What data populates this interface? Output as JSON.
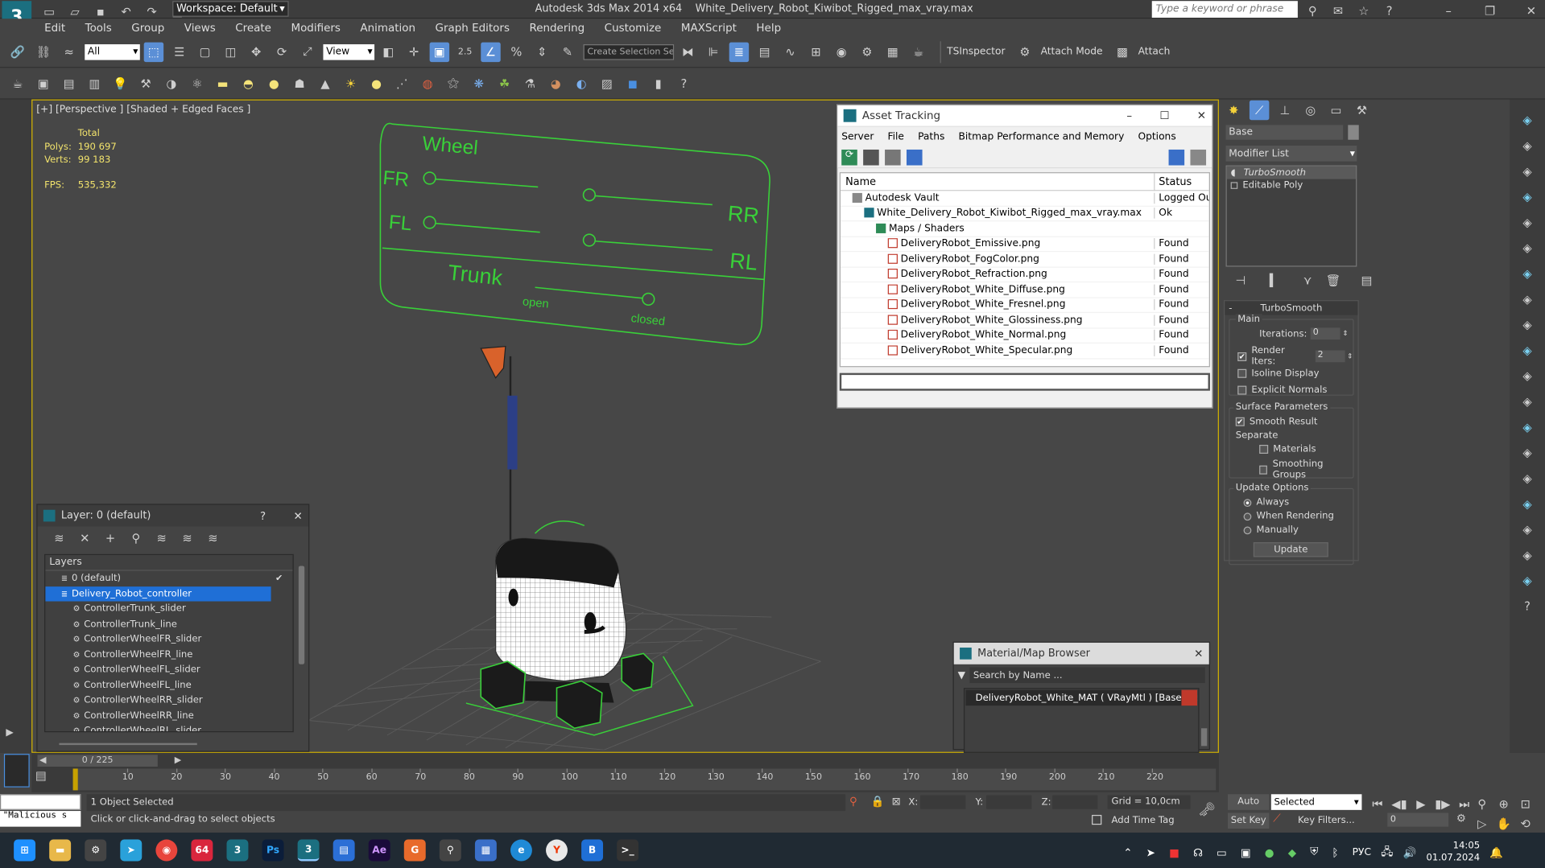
{
  "title": {
    "workspace": "Workspace: Default",
    "app": "Autodesk 3ds Max  2014 x64",
    "file": "White_Delivery_Robot_Kiwibot_Rigged_max_vray.max",
    "search_placeholder": "Type a keyword or phrase"
  },
  "menu": [
    "Edit",
    "Tools",
    "Group",
    "Views",
    "Create",
    "Modifiers",
    "Animation",
    "Graph Editors",
    "Rendering",
    "Customize",
    "MAXScript",
    "Help"
  ],
  "toolbar": {
    "filter": "All",
    "ref_coord": "View",
    "snap_value": "2.5",
    "selection_set_placeholder": "Create Selection Se",
    "tsinspector": "TSInspector",
    "attach_mode": "Attach Mode",
    "attach": "Attach"
  },
  "viewport": {
    "label": "[+] [Perspective ] [Shaded + Edged Faces ]",
    "stats_total": "Total",
    "polys_label": "Polys:",
    "polys_value": "190 697",
    "verts_label": "Verts:",
    "verts_value": "99 183",
    "fps_label": "FPS:",
    "fps_value": "535,332",
    "controller": {
      "wheel": "Wheel",
      "fr": "FR",
      "fl": "FL",
      "rr": "RR",
      "rl": "RL",
      "trunk": "Trunk",
      "open": "open",
      "closed": "closed"
    }
  },
  "asset_tracking": {
    "title": "Asset Tracking",
    "menu": [
      "Server",
      "File",
      "Paths",
      "Bitmap Performance and Memory",
      "Options"
    ],
    "col_name": "Name",
    "col_status": "Status",
    "rows": [
      {
        "name": "Autodesk Vault",
        "status": "Logged Out",
        "indent": 1,
        "icon": "vault-icon"
      },
      {
        "name": "White_Delivery_Robot_Kiwibot_Rigged_max_vray.max",
        "status": "Ok",
        "indent": 2,
        "icon": "max-file-icon"
      },
      {
        "name": "Maps / Shaders",
        "status": "",
        "indent": 3,
        "icon": "maps-icon"
      },
      {
        "name": "DeliveryRobot_Emissive.png",
        "status": "Found",
        "indent": 4,
        "icon": "png-icon"
      },
      {
        "name": "DeliveryRobot_FogColor.png",
        "status": "Found",
        "indent": 4,
        "icon": "png-icon"
      },
      {
        "name": "DeliveryRobot_Refraction.png",
        "status": "Found",
        "indent": 4,
        "icon": "png-icon"
      },
      {
        "name": "DeliveryRobot_White_Diffuse.png",
        "status": "Found",
        "indent": 4,
        "icon": "png-icon"
      },
      {
        "name": "DeliveryRobot_White_Fresnel.png",
        "status": "Found",
        "indent": 4,
        "icon": "png-icon"
      },
      {
        "name": "DeliveryRobot_White_Glossiness.png",
        "status": "Found",
        "indent": 4,
        "icon": "png-icon"
      },
      {
        "name": "DeliveryRobot_White_Normal.png",
        "status": "Found",
        "indent": 4,
        "icon": "png-icon"
      },
      {
        "name": "DeliveryRobot_White_Specular.png",
        "status": "Found",
        "indent": 4,
        "icon": "png-icon"
      }
    ]
  },
  "layer_explorer": {
    "title": "Layer: 0 (default)",
    "help": "?",
    "header": "Layers",
    "rows": [
      {
        "name": "0 (default)",
        "level": 0,
        "selected": false
      },
      {
        "name": "Delivery_Robot_controller",
        "level": 0,
        "selected": true
      },
      {
        "name": "ControllerTrunk_slider",
        "level": 1,
        "selected": false
      },
      {
        "name": "ControllerTrunk_line",
        "level": 1,
        "selected": false
      },
      {
        "name": "ControllerWheelFR_slider",
        "level": 1,
        "selected": false
      },
      {
        "name": "ControllerWheelFR_line",
        "level": 1,
        "selected": false
      },
      {
        "name": "ControllerWheelFL_slider",
        "level": 1,
        "selected": false
      },
      {
        "name": "ControllerWheelFL_line",
        "level": 1,
        "selected": false
      },
      {
        "name": "ControllerWheelRR_slider",
        "level": 1,
        "selected": false
      },
      {
        "name": "ControllerWheelRR_line",
        "level": 1,
        "selected": false
      },
      {
        "name": "ControllerWheelRL_slider",
        "level": 1,
        "selected": false
      }
    ]
  },
  "material_browser": {
    "title": "Material/Map Browser",
    "search_placeholder": "Search by Name ...",
    "item": "DeliveryRobot_White_MAT ( VRayMtl ) [Base, Ba..."
  },
  "command_panel": {
    "object_name": "Base",
    "modifier_list": "Modifier List",
    "stack": [
      "TurboSmooth",
      "Editable Poly"
    ],
    "rollout_title": "TurboSmooth",
    "main_group": "Main",
    "iterations_label": "Iterations:",
    "iterations_value": "0",
    "render_iters_label": "Render Iters:",
    "render_iters_value": "2",
    "isoline_display": "Isoline Display",
    "explicit_normals": "Explicit Normals",
    "surface_params": "Surface Parameters",
    "smooth_result": "Smooth Result",
    "separate": "Separate",
    "materials": "Materials",
    "smoothing_groups": "Smoothing Groups",
    "update_options": "Update Options",
    "always": "Always",
    "when_rendering": "When Rendering",
    "manually": "Manually",
    "update_button": "Update"
  },
  "timeline": {
    "frame_counter": "0 / 225",
    "ticks": [
      "10",
      "20",
      "30",
      "40",
      "50",
      "60",
      "70",
      "80",
      "90",
      "100",
      "110",
      "120",
      "130",
      "140",
      "150",
      "160",
      "170",
      "180",
      "190",
      "200",
      "210",
      "220"
    ]
  },
  "status": {
    "maxscript": "\"Malicious s",
    "selected": "1 Object Selected",
    "prompt": "Click or click-and-drag to select objects",
    "x_label": "X:",
    "y_label": "Y:",
    "z_label": "Z:",
    "grid": "Grid = 10,0cm",
    "add_time_tag": "Add Time Tag",
    "auto_key": "Auto Key",
    "set_key": "Set Key",
    "key_mode": "Selected",
    "key_filters": "Key Filters...",
    "frame": "0"
  },
  "taskbar": {
    "badge": "64",
    "lang": "РУС",
    "time": "14:05",
    "date": "01.07.2024"
  },
  "colors": {
    "wire_green": "#39d039",
    "selection_blue": "#1f6fd6",
    "found_png_red": "#c0392b"
  }
}
